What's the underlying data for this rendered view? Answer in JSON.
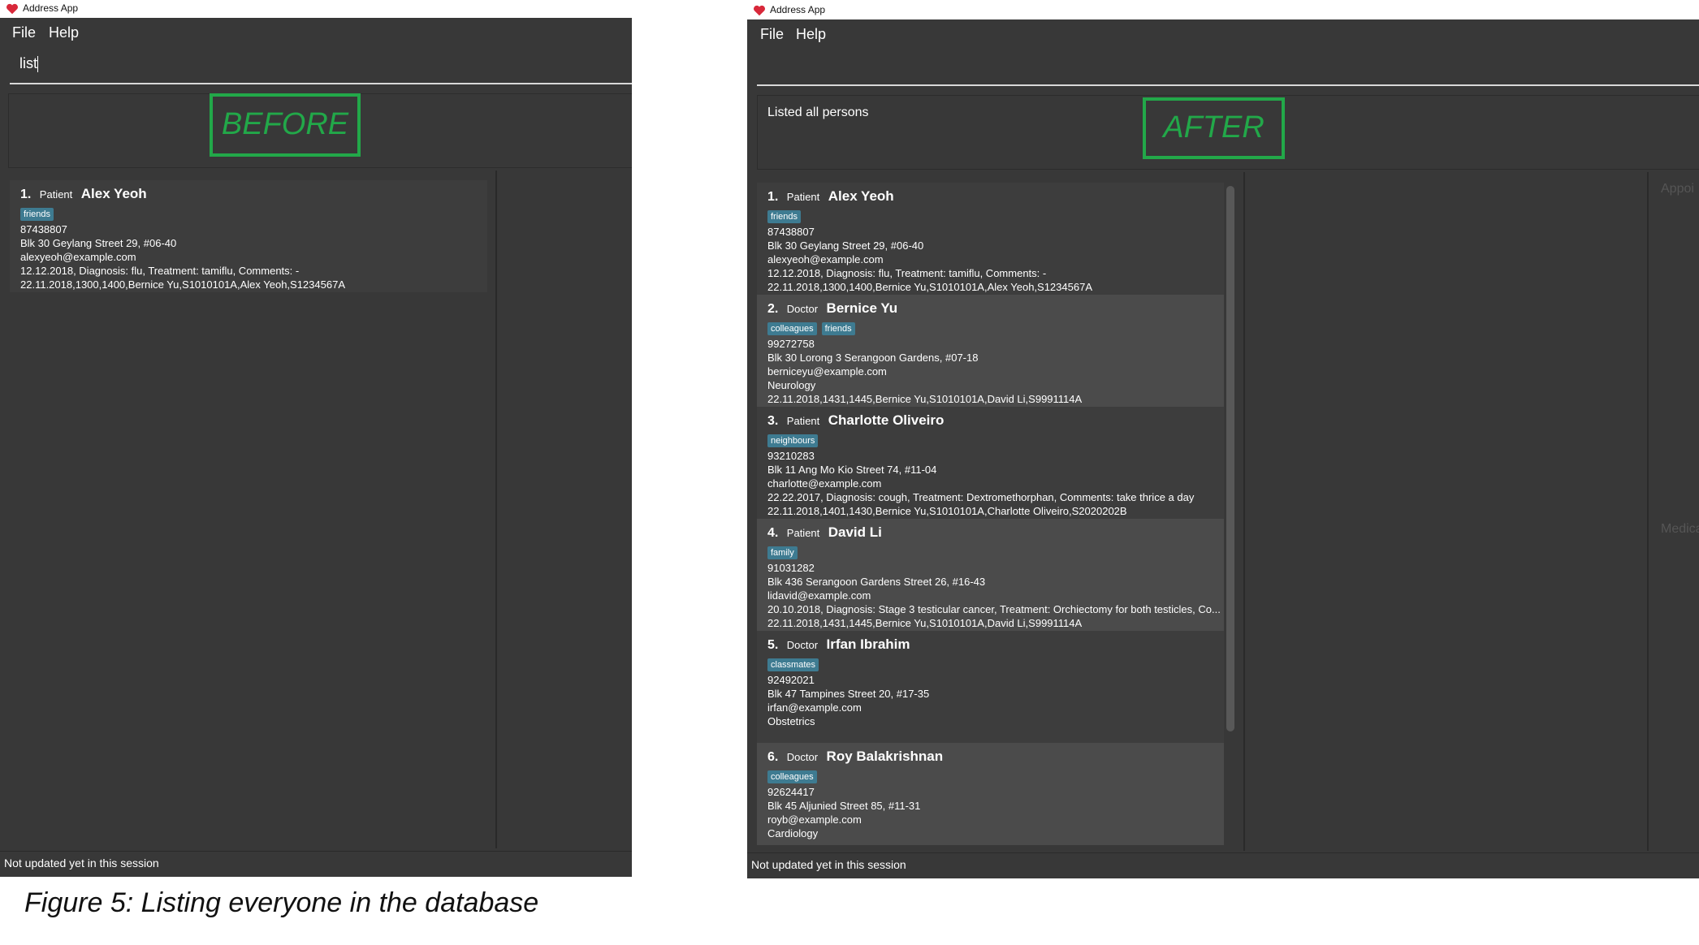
{
  "app_title": "Address App",
  "menu": {
    "file": "File",
    "help": "Help"
  },
  "before": {
    "stamp": "BEFORE",
    "command_value": "list",
    "result_message": "",
    "status": "Not updated yet in this session",
    "persons": [
      {
        "index": "1.",
        "type": "Patient",
        "name": "Alex Yeoh",
        "tags": [
          "friends"
        ],
        "lines": [
          "87438807",
          "Blk 30 Geylang Street 29, #06-40",
          "alexyeoh@example.com",
          "12.12.2018, Diagnosis: flu, Treatment: tamiflu, Comments: -",
          "22.11.2018,1300,1400,Bernice Yu,S1010101A,Alex Yeoh,S1234567A"
        ]
      }
    ]
  },
  "after": {
    "stamp": "AFTER",
    "command_value": "",
    "result_message": "Listed all persons",
    "status": "Not updated yet in this session",
    "side_labels": [
      "Appoi",
      "Medica"
    ],
    "persons": [
      {
        "index": "1.",
        "type": "Patient",
        "name": "Alex Yeoh",
        "tags": [
          "friends"
        ],
        "lines": [
          "87438807",
          "Blk 30 Geylang Street 29, #06-40",
          "alexyeoh@example.com",
          "12.12.2018, Diagnosis: flu, Treatment: tamiflu, Comments: -",
          "22.11.2018,1300,1400,Bernice Yu,S1010101A,Alex Yeoh,S1234567A"
        ]
      },
      {
        "index": "2.",
        "type": "Doctor",
        "name": "Bernice Yu",
        "tags": [
          "colleagues",
          "friends"
        ],
        "lines": [
          "99272758",
          "Blk 30 Lorong 3 Serangoon Gardens, #07-18",
          "berniceyu@example.com",
          "Neurology",
          "22.11.2018,1431,1445,Bernice Yu,S1010101A,David Li,S9991114A"
        ]
      },
      {
        "index": "3.",
        "type": "Patient",
        "name": "Charlotte Oliveiro",
        "tags": [
          "neighbours"
        ],
        "lines": [
          "93210283",
          "Blk 11 Ang Mo Kio Street 74, #11-04",
          "charlotte@example.com",
          "22.22.2017, Diagnosis: cough, Treatment: Dextromethorphan, Comments: take thrice a day",
          "22.11.2018,1401,1430,Bernice Yu,S1010101A,Charlotte Oliveiro,S2020202B"
        ]
      },
      {
        "index": "4.",
        "type": "Patient",
        "name": "David Li",
        "tags": [
          "family"
        ],
        "lines": [
          "91031282",
          "Blk 436 Serangoon Gardens Street 26, #16-43",
          "lidavid@example.com",
          "20.10.2018, Diagnosis: Stage 3 testicular cancer, Treatment: Orchiectomy for both testicles, Co...",
          "22.11.2018,1431,1445,Bernice Yu,S1010101A,David Li,S9991114A"
        ]
      },
      {
        "index": "5.",
        "type": "Doctor",
        "name": "Irfan Ibrahim",
        "tags": [
          "classmates"
        ],
        "lines": [
          "92492021",
          "Blk 47 Tampines Street 20, #17-35",
          "irfan@example.com",
          "Obstetrics"
        ]
      },
      {
        "index": "6.",
        "type": "Doctor",
        "name": "Roy Balakrishnan",
        "tags": [
          "colleagues"
        ],
        "lines": [
          "92624417",
          "Blk 45 Aljunied Street 85, #11-31",
          "royb@example.com",
          "Cardiology"
        ]
      }
    ]
  },
  "caption": "Figure 5: Listing everyone in the database"
}
